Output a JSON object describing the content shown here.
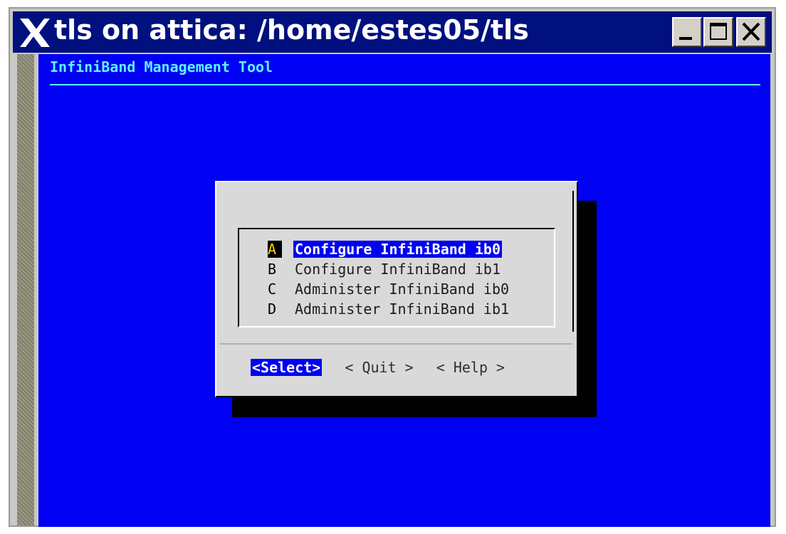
{
  "window": {
    "title": "tls on attica: /home/estes05/tls",
    "controls": {
      "minimize_icon": "minimize-icon",
      "maximize_icon": "maximize-icon",
      "close_icon": "close-icon"
    }
  },
  "terminal": {
    "app_title": "InfiniBand Management Tool",
    "menu": {
      "items": [
        {
          "tag": "A",
          "label": "Configure InfiniBand ib0",
          "selected": true
        },
        {
          "tag": "B",
          "label": "Configure InfiniBand ib1",
          "selected": false
        },
        {
          "tag": "C",
          "label": "Administer InfiniBand ib0",
          "selected": false
        },
        {
          "tag": "D",
          "label": "Administer InfiniBand ib1",
          "selected": false
        }
      ]
    },
    "buttons": {
      "select": "<Select>",
      "quit": "< Quit >",
      "help": "< Help >"
    }
  },
  "colors": {
    "titlebar": "#00107e",
    "terminal_bg": "#0000f2",
    "header_text": "#5ff2ff",
    "dialog_bg": "#d9d9d9",
    "tag_highlight": "#ffd200"
  }
}
